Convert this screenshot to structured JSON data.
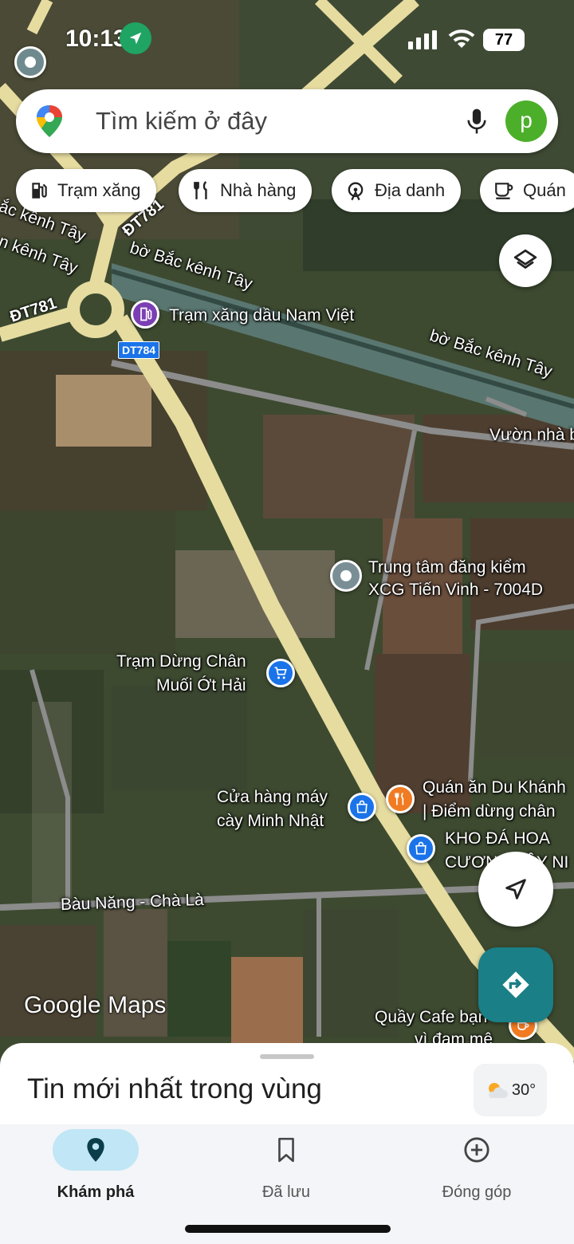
{
  "status_bar": {
    "time": "10:13",
    "battery": "77"
  },
  "search": {
    "placeholder": "Tìm kiếm ở đây",
    "avatar_letter": "p"
  },
  "chips": [
    {
      "label": "Trạm xăng",
      "icon": "gas-station-icon"
    },
    {
      "label": "Nhà hàng",
      "icon": "restaurant-icon"
    },
    {
      "label": "Địa danh",
      "icon": "landmark-icon"
    },
    {
      "label": "Quán",
      "icon": "coffee-icon"
    }
  ],
  "map": {
    "roads": {
      "road_1": "ĐT781",
      "road_2": "ĐT781",
      "canal_1": "bờ Bắc kênh Tây",
      "canal_2": "bờ Bắc kênh Tây",
      "canal_left_1": "ắc kênh Tây",
      "canal_left_2": "n kênh Tây",
      "shield": "DT784",
      "road_bottom": "Bàu Năng - Chà Là"
    },
    "places": {
      "gas_station": "Trạm xăng dầu Nam Việt",
      "garden": "Vườn nhà b",
      "inspection_1": "Trung tâm đăng kiểm",
      "inspection_2": "XCG Tiến Vinh - 7004D",
      "stop_1": "Trạm Dừng Chân",
      "stop_2": "Muối Ớt Hải",
      "shop_1": "Cửa hàng máy",
      "shop_2": "cày Minh Nhật",
      "restaurant_1": "Quán ăn Du Khánh",
      "restaurant_2": "| Điểm dừng chân",
      "stone_1": "KHO ĐÁ HOA",
      "stone_2": "CƯƠNG TÂY NI",
      "cafe_1": "Quầy Cafe bạn",
      "cafe_2": "vì đam mê"
    },
    "watermark": "Google Maps"
  },
  "sheet": {
    "title": "Tin mới nhất trong vùng",
    "weather": "30°"
  },
  "nav": {
    "explore": "Khám phá",
    "saved": "Đã lưu",
    "contribute": "Đóng góp"
  }
}
